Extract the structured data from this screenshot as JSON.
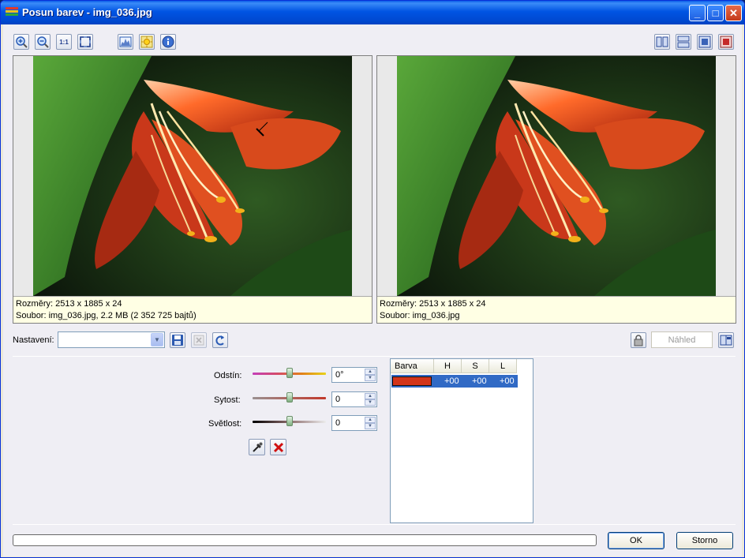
{
  "window": {
    "title": "Posun barev - img_036.jpg",
    "minimize": "_",
    "maximize": "□",
    "close": "✕"
  },
  "toolbar": {
    "left_icons": [
      "zoom-in-icon",
      "zoom-out-icon",
      "actual-size-icon",
      "fit-window-icon",
      "histogram-icon",
      "auto-adjust-icon",
      "info-icon"
    ],
    "actual_size_label": "1:1",
    "right_icons": [
      "split-vertical-icon",
      "split-horizontal-icon",
      "single-view-icon",
      "original-view-icon"
    ]
  },
  "original": {
    "dimensions": "Rozměry: 2513 x 1885 x 24",
    "file": "Soubor: img_036.jpg, 2.2 MB (2 352 725 bajtů)"
  },
  "preview": {
    "dimensions": "Rozměry: 2513 x 1885 x 24",
    "file": "Soubor: img_036.jpg"
  },
  "settings": {
    "label": "Nastavení:",
    "value": "",
    "preview_placeholder": "Náhled"
  },
  "adjust": {
    "hue": {
      "label": "Odstín:",
      "value": "0°",
      "level": 0.5
    },
    "saturation": {
      "label": "Sytost:",
      "value": "0",
      "level": 0.5
    },
    "lightness": {
      "label": "Světlost:",
      "value": "0",
      "level": 0.5
    }
  },
  "colors_table": {
    "headers": [
      "Barva",
      "H",
      "S",
      "L"
    ],
    "rows": [
      {
        "swatch": "#d2351a",
        "h": "+00",
        "s": "+00",
        "l": "+00"
      }
    ]
  },
  "progress": 0,
  "buttons": {
    "ok": "OK",
    "cancel": "Storno"
  }
}
